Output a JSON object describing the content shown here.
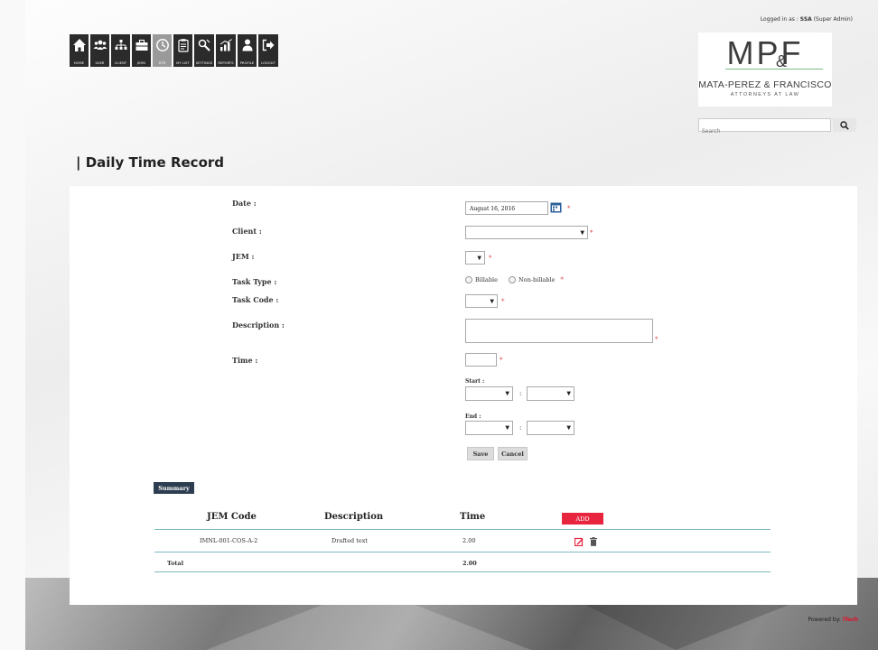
{
  "header": {
    "logged_in_prefix": "Logged in as : ",
    "logged_in_user": "SSA",
    "logged_in_role": " (Super Admin)"
  },
  "nav": [
    {
      "label": "HOME",
      "icon": "home-icon"
    },
    {
      "label": "USER",
      "icon": "users-icon"
    },
    {
      "label": "CLIENT",
      "icon": "sitemap-icon"
    },
    {
      "label": "JEMS",
      "icon": "briefcase-icon"
    },
    {
      "label": "DTR",
      "icon": "clock-icon",
      "active": true
    },
    {
      "label": "MY LIST",
      "icon": "clipboard-icon"
    },
    {
      "label": "SETTINGS",
      "icon": "wrench-icon"
    },
    {
      "label": "REPORTS",
      "icon": "chart-icon"
    },
    {
      "label": "PROFILE",
      "icon": "person-icon"
    },
    {
      "label": "LOGOUT",
      "icon": "logout-icon"
    }
  ],
  "logo": {
    "mpf": "MPF",
    "amp": "&",
    "firm": "MATA-PEREZ & FRANCISCO",
    "sub": "ATTORNEYS AT LAW"
  },
  "search": {
    "placeholder": "Search"
  },
  "page_title": "| Daily Time Record",
  "form": {
    "date_label": "Date :",
    "date_value": "August 16, 2016",
    "client_label": "Client :",
    "jem_label": "JEM :",
    "task_type_label": "Task Type :",
    "billable_label": "Billable",
    "non_billable_label": "Non-billable",
    "task_code_label": "Task Code :",
    "description_label": "Description :",
    "time_label": "Time :",
    "start_label": "Start :",
    "end_label": "End :",
    "required_mark": "*",
    "colon": ":",
    "save_label": "Save",
    "cancel_label": "Cancel"
  },
  "summary": {
    "tag": "Summary",
    "columns": [
      "JEM Code",
      "Description",
      "Time"
    ],
    "add_label": "ADD",
    "rows": [
      {
        "jem_code": "IMNL-001-COS-A-2",
        "description": "Drafted text",
        "time": "2.00"
      }
    ],
    "total_label": "Total",
    "total_value": "2.00"
  },
  "footer": {
    "powered_prefix": "Powered by: ",
    "powered_brand": "iTech"
  },
  "colors": {
    "nav_bg": "#2b2b2b",
    "nav_active": "#9a9a9a",
    "add_button": "#e8253f",
    "summary_tag": "#2d3e50",
    "table_rule": "#7fb9c0"
  }
}
